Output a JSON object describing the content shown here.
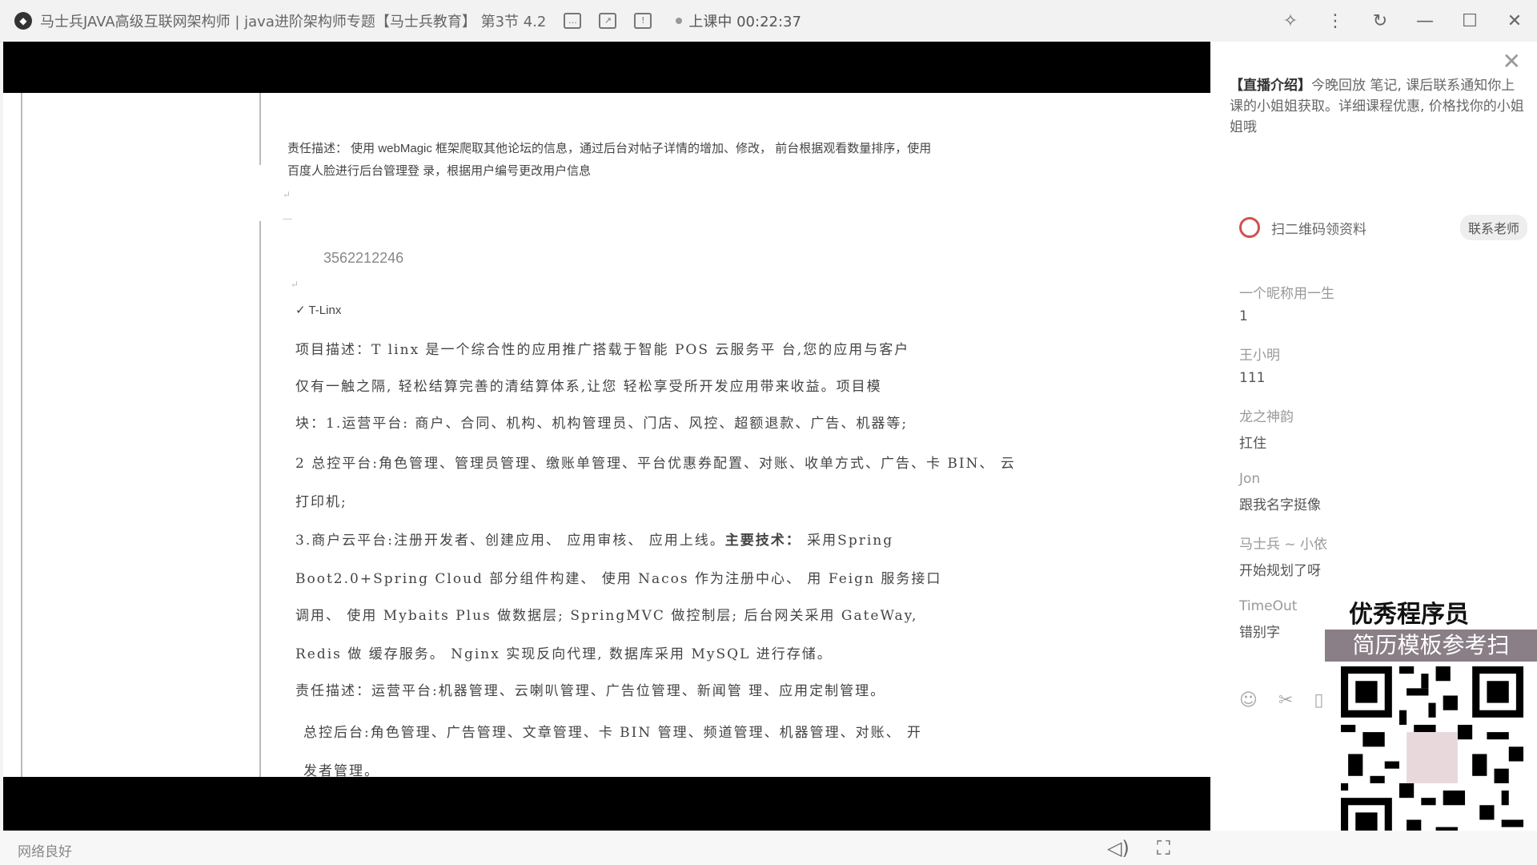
{
  "window": {
    "title": "马士兵JAVA高级互联网架构师 | java进阶架构师专题【马士兵教育】 第3节 4.2",
    "status": "上课中 00:22:37"
  },
  "doc": {
    "resp1": "责任描述：  使用 webMagic 框架爬取其他论坛的信息，通过后台对帖子详情的增加、修改，  前台根据观看数量排序，使用",
    "resp2": "百度人脸进行后台管理登 录，根据用户编号更改用户信息",
    "phone": "3562212246",
    "project": "T-Linx",
    "l1": "项目描述：T linx 是一个综合性的应用推广搭载于智能 POS 云服务平  台,您的应用与客户",
    "l2": "仅有一触之隔, 轻松结算完善的清结算体系,让您 轻松享受所开发应用带来收益。项目模",
    "l3": "块：1.运营平台:    商户、合同、机构、机构管理员、门店、风控、超额退款、广告、机器等;",
    "l4": "2  总控平台:角色管理、管理员管理、缴账单管理、平台优惠券配置、对账、收单方式、广告、卡 BIN、 云",
    "l5": "打印机;",
    "l6a": "3.商户云平台:注册开发者、创建应用、 应用审核、 应用上线。",
    "l6b": "主要技术：",
    "l6c": " 采用Spring",
    "l7": "Boot2.0+Spring Cloud 部分组件构建、  使用  Nacos 作为注册中心、  用 Feign 服务接口",
    "l8": "调用、  使用 Mybaits Plus 做数据层;   SpringMVC 做控制层;  后台网关采用 GateWay,",
    "l9": "Redis 做 缓存服务。 Nginx 实现反向代理, 数据库采用 MySQL 进行存储。",
    "l10": "责任描述：运营平台:机器管理、云喇叭管理、广告位管理、新闻管 理、应用定制管理。",
    "l11": "总控后台:角色管理、广告管理、文章管理、卡 BIN 管理、频道管理、机器管理、对账、  开",
    "l12": "发者管理。"
  },
  "sidebar": {
    "intro_bold": "【直播介绍】",
    "intro": "今晚回放 笔记, 课后联系通知你上课的小姐姐获取。详细课程优惠, 价格找你的小姐姐哦",
    "qr_text": "扫二维码领资料",
    "teacher_btn": "联系老师",
    "messages": [
      {
        "name": "一个昵称用一生",
        "text": "1"
      },
      {
        "name": "王小明",
        "text": "111"
      },
      {
        "name": "龙之神韵",
        "text": "扛住"
      },
      {
        "name": "Jon",
        "text": "跟我名字挺像"
      },
      {
        "name": "马士兵 ~ 小依",
        "text": "开始规划了呀"
      },
      {
        "name": "TimeOut",
        "text": "错别字"
      }
    ]
  },
  "ad": {
    "title": "优秀程序员",
    "subtitle": "简历模板参考扫"
  },
  "bottom": {
    "network": "网络良好"
  }
}
